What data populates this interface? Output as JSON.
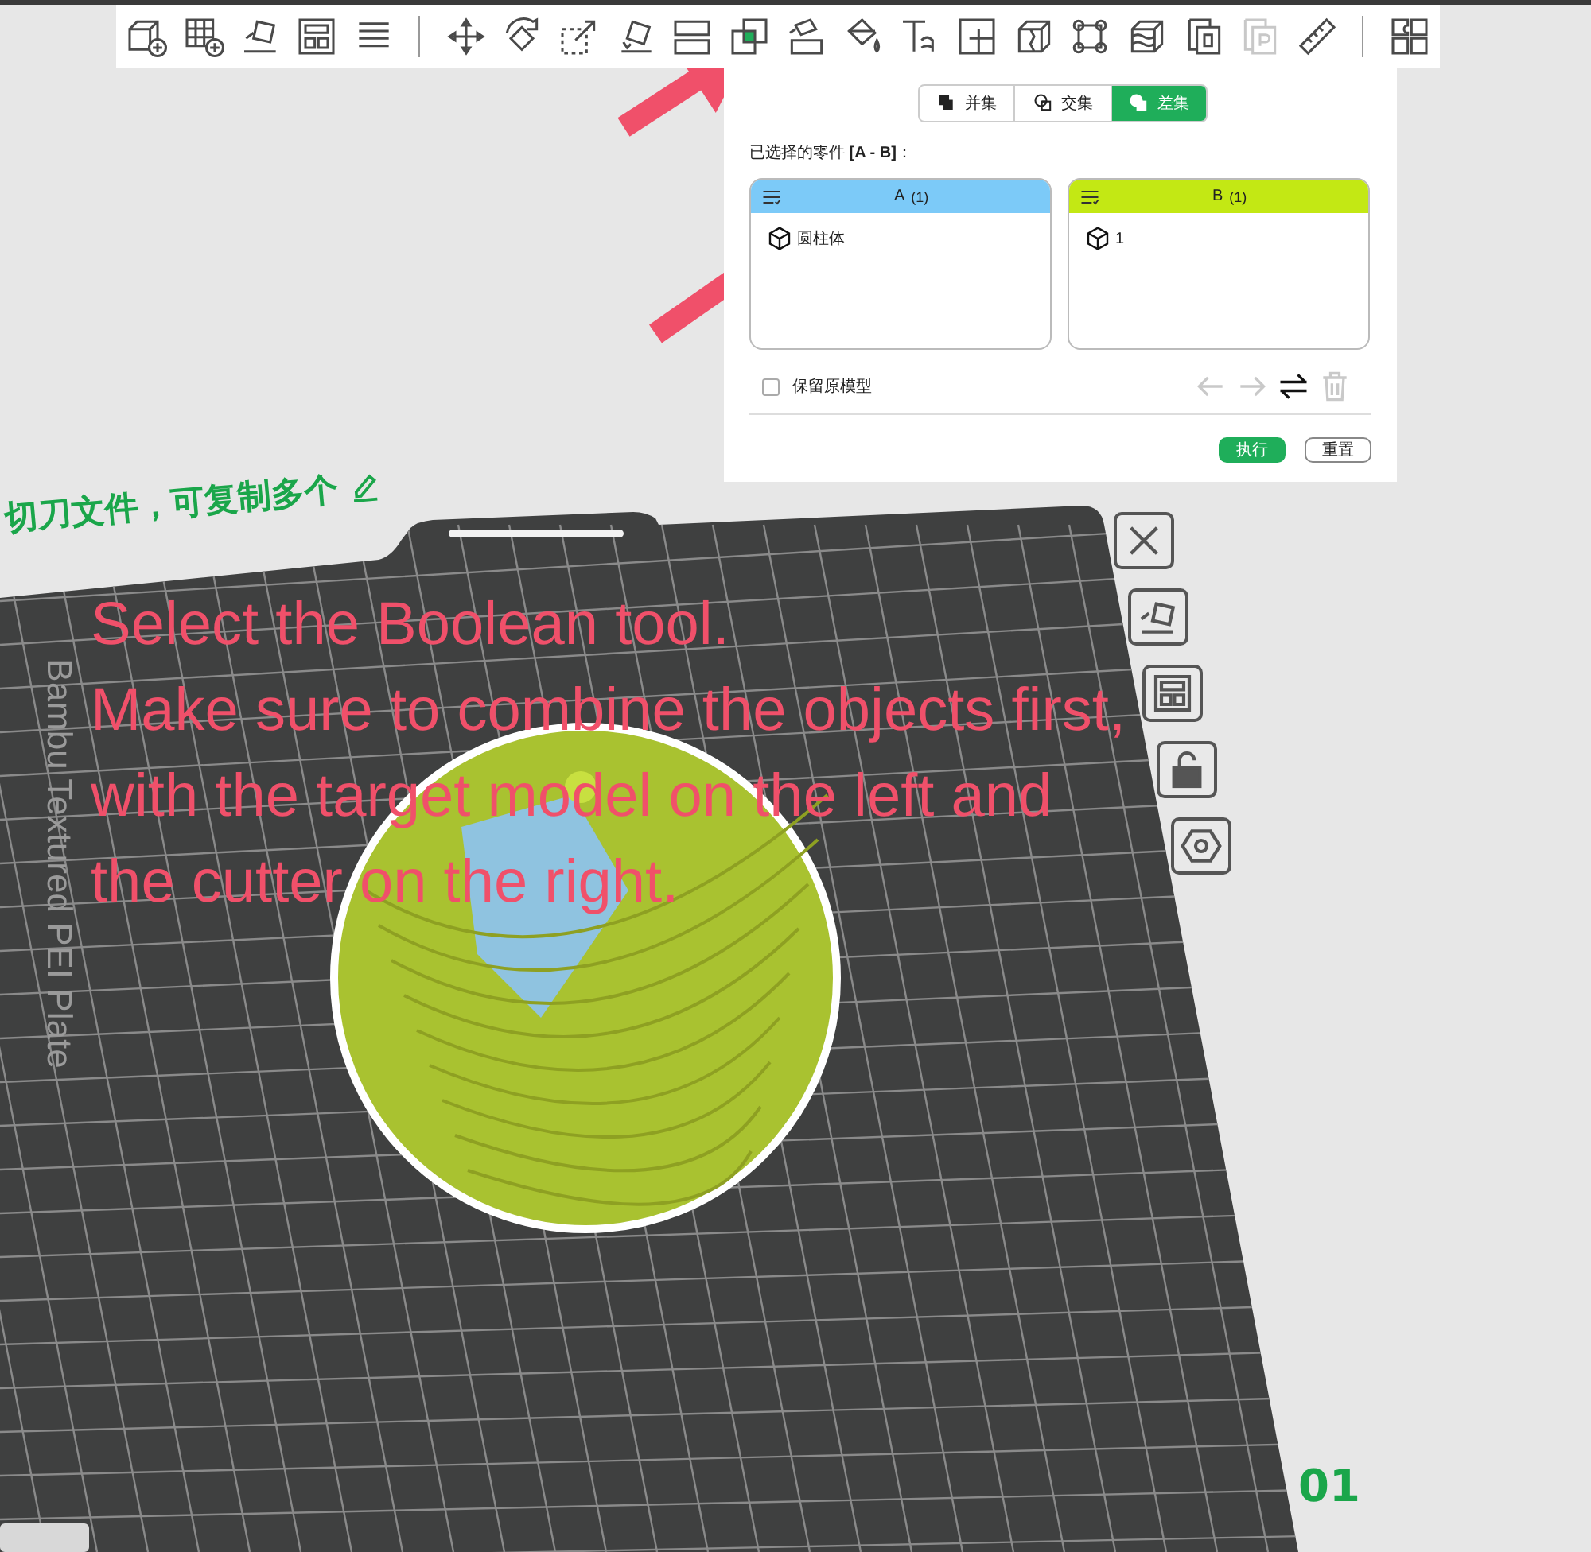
{
  "toolbar": {
    "groups": [
      {
        "items": [
          {
            "selected": false,
            "disabled": false
          },
          {
            "selected": false,
            "disabled": false
          },
          {
            "selected": false,
            "disabled": false
          },
          {
            "selected": false,
            "disabled": false
          },
          {
            "selected": false,
            "disabled": false
          }
        ]
      },
      {
        "items": [
          {
            "selected": false,
            "disabled": false
          },
          {
            "selected": false,
            "disabled": false
          },
          {
            "selected": false,
            "disabled": false
          },
          {
            "selected": false,
            "disabled": false
          },
          {
            "selected": false,
            "disabled": false
          },
          {
            "selected": true,
            "disabled": false
          },
          {
            "selected": false,
            "disabled": false
          },
          {
            "selected": false,
            "disabled": false
          },
          {
            "selected": false,
            "disabled": false
          },
          {
            "selected": false,
            "disabled": false
          },
          {
            "selected": false,
            "disabled": false
          },
          {
            "selected": false,
            "disabled": false
          },
          {
            "selected": false,
            "disabled": false
          },
          {
            "selected": false,
            "disabled": false
          },
          {
            "selected": false,
            "disabled": true
          },
          {
            "selected": false,
            "disabled": false
          }
        ]
      },
      {
        "items": [
          {
            "selected": false,
            "disabled": false
          }
        ]
      }
    ]
  },
  "boolean_panel": {
    "tabs": [
      {
        "label": "并集",
        "kind": "union",
        "selected": false
      },
      {
        "label": "交集",
        "kind": "intersection",
        "selected": false
      },
      {
        "label": "差集",
        "kind": "difference",
        "selected": true
      }
    ],
    "selection_label": "已选择的零件 **[A - B]**：",
    "lists": [
      {
        "title": "A",
        "count": "(1)",
        "color": "#7ccaf8",
        "items": [
          {
            "name": "圆柱体"
          }
        ]
      },
      {
        "title": "B",
        "count": "(1)",
        "color": "#c3e814",
        "items": [
          {
            "name": "1"
          }
        ]
      }
    ],
    "keep_original": {
      "label": "保留原模型",
      "checked": false
    },
    "actions": [
      {
        "kind": "left",
        "disabled": true
      },
      {
        "kind": "right",
        "disabled": true
      },
      {
        "kind": "swap",
        "disabled": false
      },
      {
        "kind": "delete",
        "disabled": true
      }
    ],
    "buttons": [
      {
        "label": "执行",
        "kind": "primary"
      },
      {
        "label": "重置",
        "kind": "secondary"
      }
    ]
  },
  "canvas": {
    "plate_note": "切刀文件，可复制多个",
    "plate_label": "Bambu Textured PEI Plate",
    "plate_number": "01"
  },
  "annotation": {
    "lines": [
      "Select the Boolean tool.",
      "Make sure to combine the objects first,",
      "with the target model on the left and",
      "the cutter on the right."
    ]
  }
}
